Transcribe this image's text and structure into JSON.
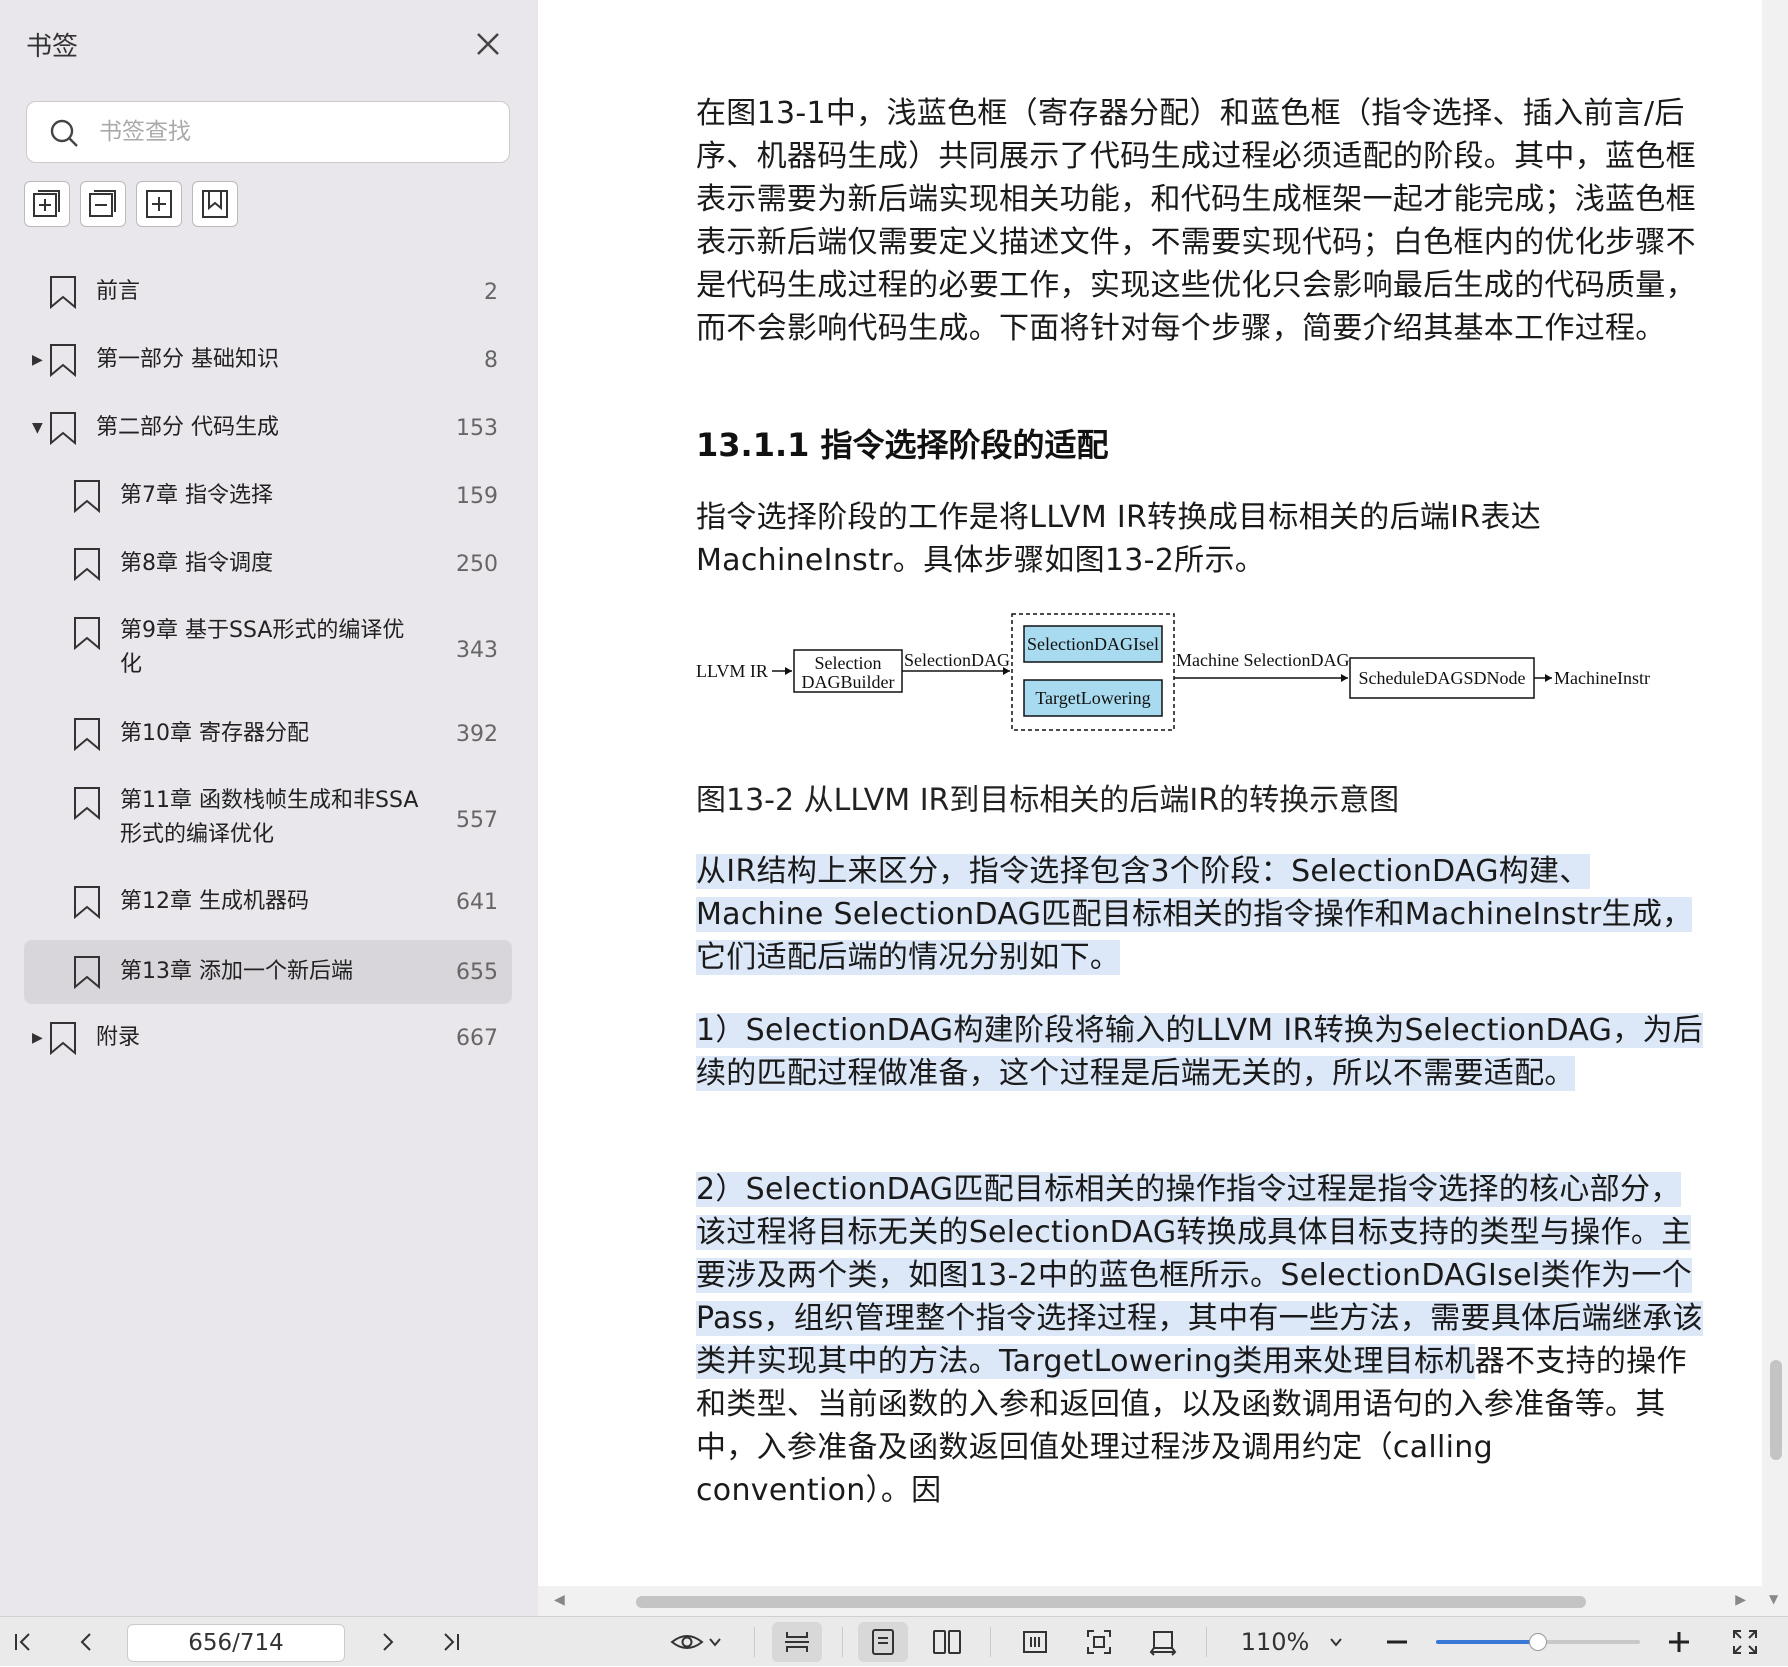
{
  "sidebar": {
    "title": "书签",
    "search_placeholder": "书签查找",
    "items": [
      {
        "label": "前言",
        "page": "2",
        "arrow": ""
      },
      {
        "label": "第一部分 基础知识",
        "page": "8",
        "arrow": "▶"
      },
      {
        "label": "第二部分 代码生成",
        "page": "153",
        "arrow": "▼"
      },
      {
        "label": "第7章 指令选择",
        "page": "159",
        "arrow": ""
      },
      {
        "label": "第8章 指令调度",
        "page": "250",
        "arrow": ""
      },
      {
        "label": "第9章 基于SSA形式的编译优",
        "label2": "化",
        "page": "343",
        "arrow": ""
      },
      {
        "label": "第10章 寄存器分配",
        "page": "392",
        "arrow": ""
      },
      {
        "label": "第11章 函数栈帧生成和非SSA",
        "label2": "形式的编译优化",
        "page": "557",
        "arrow": ""
      },
      {
        "label": "第12章 生成机器码",
        "page": "641",
        "arrow": ""
      },
      {
        "label": "第13章 添加一个新后端",
        "page": "655",
        "arrow": ""
      },
      {
        "label": "附录",
        "page": "667",
        "arrow": "▶"
      }
    ]
  },
  "document": {
    "para1": "在图13-1中，浅蓝色框（寄存器分配）和蓝色框（指令选择、插入前言/后序、机器码生成）共同展示了代码生成过程必须适配的阶段。其中，蓝色框表示需要为新后端实现相关功能，和代码生成框架一起才能完成；浅蓝色框表示新后端仅需要定义描述文件，不需要实现代码；白色框内的优化步骤不是代码生成过程的必要工作，实现这些优化只会影响最后生成的代码质量，而不会影响代码生成。下面将针对每个步骤，简要介绍其基本工作过程。",
    "heading": "13.1.1 指令选择阶段的适配",
    "para2": "指令选择阶段的工作是将LLVM IR转换成目标相关的后端IR表达MachineInstr。具体步骤如图13-2所示。",
    "diagram": {
      "llvm_ir": "LLVM IR",
      "builder_line1": "Selection",
      "builder_line2": "DAGBuilder",
      "sel_dag": "SelectionDAG",
      "isel": "SelectionDAGIsel",
      "lowering": "TargetLowering",
      "machine_sel_dag": "Machine SelectionDAG",
      "schedule": "ScheduleDAGSDNode",
      "machine_instr": "MachineInstr"
    },
    "caption": "图13-2 从LLVM IR到目标相关的后端IR的转换示意图",
    "para3": "从IR结构上来区分，指令选择包含3个阶段：SelectionDAG构建、Machine SelectionDAG匹配目标相关的指令操作和MachineInstr生成，它们适配后端的情况分别如下。",
    "para4": "1）SelectionDAG构建阶段将输入的LLVM IR转换为SelectionDAG，为后续的匹配过程做准备，这个过程是后端无关的，所以不需要适配。",
    "para5_hl": "2）SelectionDAG匹配目标相关的操作指令过程是指令选择的核心部分，该过程将目标无关的SelectionDAG转换成具体目标支持的类型与操作。主要涉及两个类，如图13-2中的蓝色框所示。SelectionDAGIsel类作为一个Pass，组织管理整个指令选择过程，其中有一些方法，需要具体后端继承该类并实现其中的方法。TargetLowering类用来处理目标机",
    "para5_rest": "器不支持的操作和类型、当前函数的入参和返回值，以及函数调用语句的入参准备等。其中，入参准备及函数返回值处理过程涉及调用约定（calling convention）。因"
  },
  "toolbar": {
    "page_indicator": "656/714",
    "zoom": "110%",
    "zoom_level": 0.5
  },
  "colors": {
    "highlight": "#dce7f7",
    "diagram_box_fill": "#a8daf0",
    "sidebar_bg": "#e9e7ec",
    "slider_accent": "#3a78d8"
  }
}
